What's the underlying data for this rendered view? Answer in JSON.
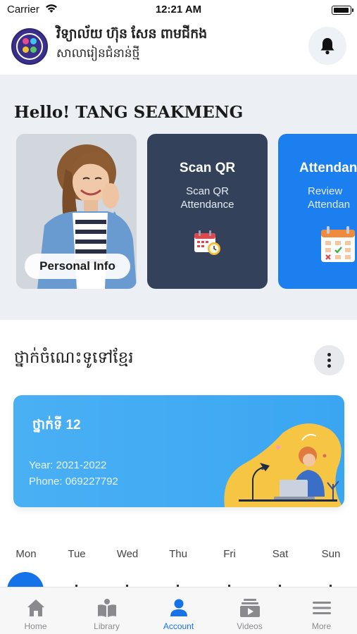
{
  "status_bar": {
    "carrier": "Carrier",
    "time": "12:21 AM"
  },
  "header": {
    "school_name": "វិទ្យាល័យ ហ៊ុន សែន ពាមជីកង",
    "school_subtitle": "សាលារៀនជំនាន់ថ្មី",
    "logo_icon": "school-logo",
    "notification_icon": "bell-icon"
  },
  "greeting": "Hello! TANG SEAKMENG",
  "cards": [
    {
      "id": "personal-info",
      "label": "Personal Info",
      "image": "smiling-student-photo"
    },
    {
      "id": "scan-qr",
      "title": "Scan QR",
      "desc_line1": "Scan QR",
      "desc_line2": "Attendance",
      "icon": "calendar-clock-icon",
      "color": "#33425a"
    },
    {
      "id": "attendance",
      "title": "Attendan",
      "desc_line1": "Review",
      "desc_line2": "Attendan",
      "icon": "calendar-check-icon",
      "color": "#1b7ff0"
    }
  ],
  "section": {
    "title": "ថ្នាក់ចំណេះទូទៅខ្មែរ",
    "more_icon": "vertical-dots-icon"
  },
  "class_card": {
    "grade": "ថ្នាក់ទី 12",
    "year": "Year: 2021-2022",
    "phone": "Phone:  069227792",
    "illustration": "student-laptop-illustration",
    "color": "#3aa6f2"
  },
  "week_days": [
    "Mon",
    "Tue",
    "Wed",
    "Thu",
    "Fri",
    "Sat",
    "Sun"
  ],
  "tabs": [
    {
      "label": "Home",
      "icon": "home-icon",
      "active": false
    },
    {
      "label": "Library",
      "icon": "book-icon",
      "active": false
    },
    {
      "label": "Account",
      "icon": "account-icon",
      "active": true
    },
    {
      "label": "Videos",
      "icon": "video-icon",
      "active": false
    },
    {
      "label": "More",
      "icon": "menu-icon",
      "active": false
    }
  ],
  "colors": {
    "accent": "#1572e8",
    "inactive_tab": "#8a8a8e",
    "band_bg": "#eceff3"
  }
}
